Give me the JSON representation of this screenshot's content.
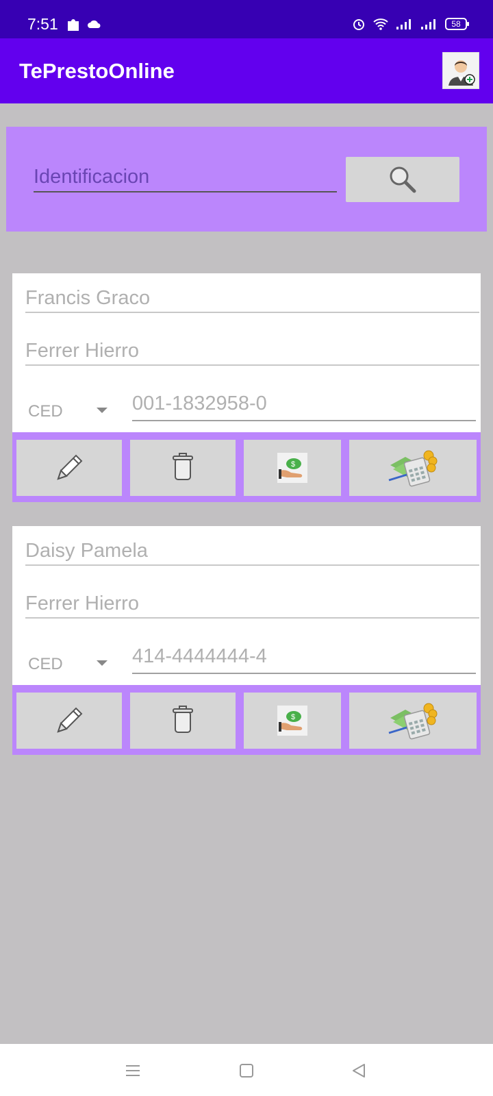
{
  "status_bar": {
    "time": "7:51",
    "battery": "58"
  },
  "app_bar": {
    "title": "TePrestoOnline"
  },
  "search": {
    "placeholder": "Identificacion"
  },
  "clients": [
    {
      "first_name": "Francis Graco",
      "last_name": "Ferrer Hierro",
      "doc_type": "CED",
      "doc_number": "001-1832958-0"
    },
    {
      "first_name": "Daisy Pamela",
      "last_name": "Ferrer Hierro",
      "doc_type": "CED",
      "doc_number": "414-4444444-4"
    }
  ],
  "colors": {
    "status_bar": "#3700b3",
    "app_bar": "#6200ee",
    "accent_panel": "#bb86fc",
    "background": "#c2c0c2"
  }
}
